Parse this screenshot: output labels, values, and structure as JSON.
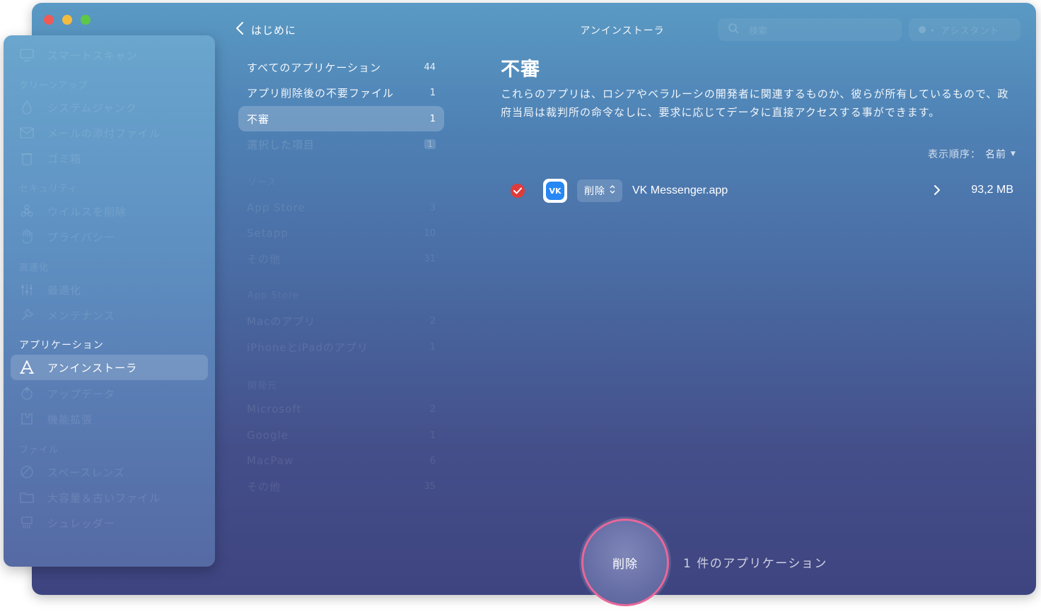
{
  "window": {
    "title": "アンインストーラ",
    "back_label": "はじめに",
    "search_placeholder": "検索",
    "assistant_label": "アシスタント"
  },
  "sidebar": {
    "items": [
      {
        "label": "スマートスキャン",
        "icon": "monitor-icon",
        "faded": true
      },
      {
        "section": "クリーンアップ"
      },
      {
        "label": "システムジャンク",
        "icon": "drop-icon",
        "faded": true
      },
      {
        "label": "メールの添付ファイル",
        "icon": "mail-icon",
        "faded": true
      },
      {
        "label": "ゴミ箱",
        "icon": "trash-icon",
        "faded": true
      },
      {
        "section": "セキュリティ"
      },
      {
        "label": "ウイルスを削除",
        "icon": "biohazard-icon",
        "faded": true
      },
      {
        "label": "プライバシー",
        "icon": "hand-icon",
        "faded": true
      },
      {
        "section": "高速化"
      },
      {
        "label": "最適化",
        "icon": "sliders-icon",
        "faded": true
      },
      {
        "label": "メンテナンス",
        "icon": "wrench-icon",
        "faded": true
      },
      {
        "section": "アプリケーション",
        "active": true
      },
      {
        "label": "アンインストーラ",
        "icon": "uninstaller-icon",
        "active": true
      },
      {
        "label": "アップデータ",
        "icon": "updater-icon",
        "faded": true
      },
      {
        "label": "機能拡張",
        "icon": "extension-icon",
        "faded": true
      },
      {
        "section": "ファイル"
      },
      {
        "label": "スペースレンズ",
        "icon": "lens-icon",
        "faded": true
      },
      {
        "label": "大容量＆古いファイル",
        "icon": "folder-icon",
        "faded": true
      },
      {
        "label": "シュレッダー",
        "icon": "shredder-icon",
        "faded": true
      }
    ]
  },
  "categories": {
    "main": [
      {
        "label": "すべてのアプリケーション",
        "count": "44"
      },
      {
        "label": "アプリ削除後の不要ファイル",
        "count": "1"
      },
      {
        "label": "不審",
        "count": "1",
        "active": true
      },
      {
        "label": "選択した項目",
        "count": "1"
      }
    ],
    "vendor_heading": "ソース",
    "vendors": [
      {
        "label": "App Store",
        "count": "3"
      },
      {
        "label": "Setapp",
        "count": "10"
      },
      {
        "label": "その他",
        "count": "31"
      }
    ],
    "store_heading": "App Store",
    "stores": [
      {
        "label": "Macのアプリ",
        "count": "2"
      },
      {
        "label": "iPhoneとiPadのアプリ",
        "count": "1"
      }
    ],
    "dev_heading": "開発元",
    "developers": [
      {
        "label": "Microsoft",
        "count": "2"
      },
      {
        "label": "Google",
        "count": "1"
      },
      {
        "label": "MacPaw",
        "count": "6"
      },
      {
        "label": "その他",
        "count": "35"
      }
    ]
  },
  "content": {
    "heading": "不審",
    "description": "これらのアプリは、ロシアやベラルーシの開発者に関連するものか、彼らが所有しているもので、政府当局は裁判所の命令なしに、要求に応じてデータに直接アクセスする事ができます。",
    "sort_label": "表示順序：",
    "sort_value": "名前",
    "apps": [
      {
        "name": "VK Messenger.app",
        "size": "93,2 MB",
        "action": "削除",
        "checked": true,
        "icon": "vk-icon"
      }
    ]
  },
  "footer": {
    "button_label": "削除",
    "caption": "1 件のアプリケーション"
  },
  "colors": {
    "accent_ring": "#e8679a",
    "check": "#e03b3b",
    "vk_brand": "#2787f5"
  }
}
